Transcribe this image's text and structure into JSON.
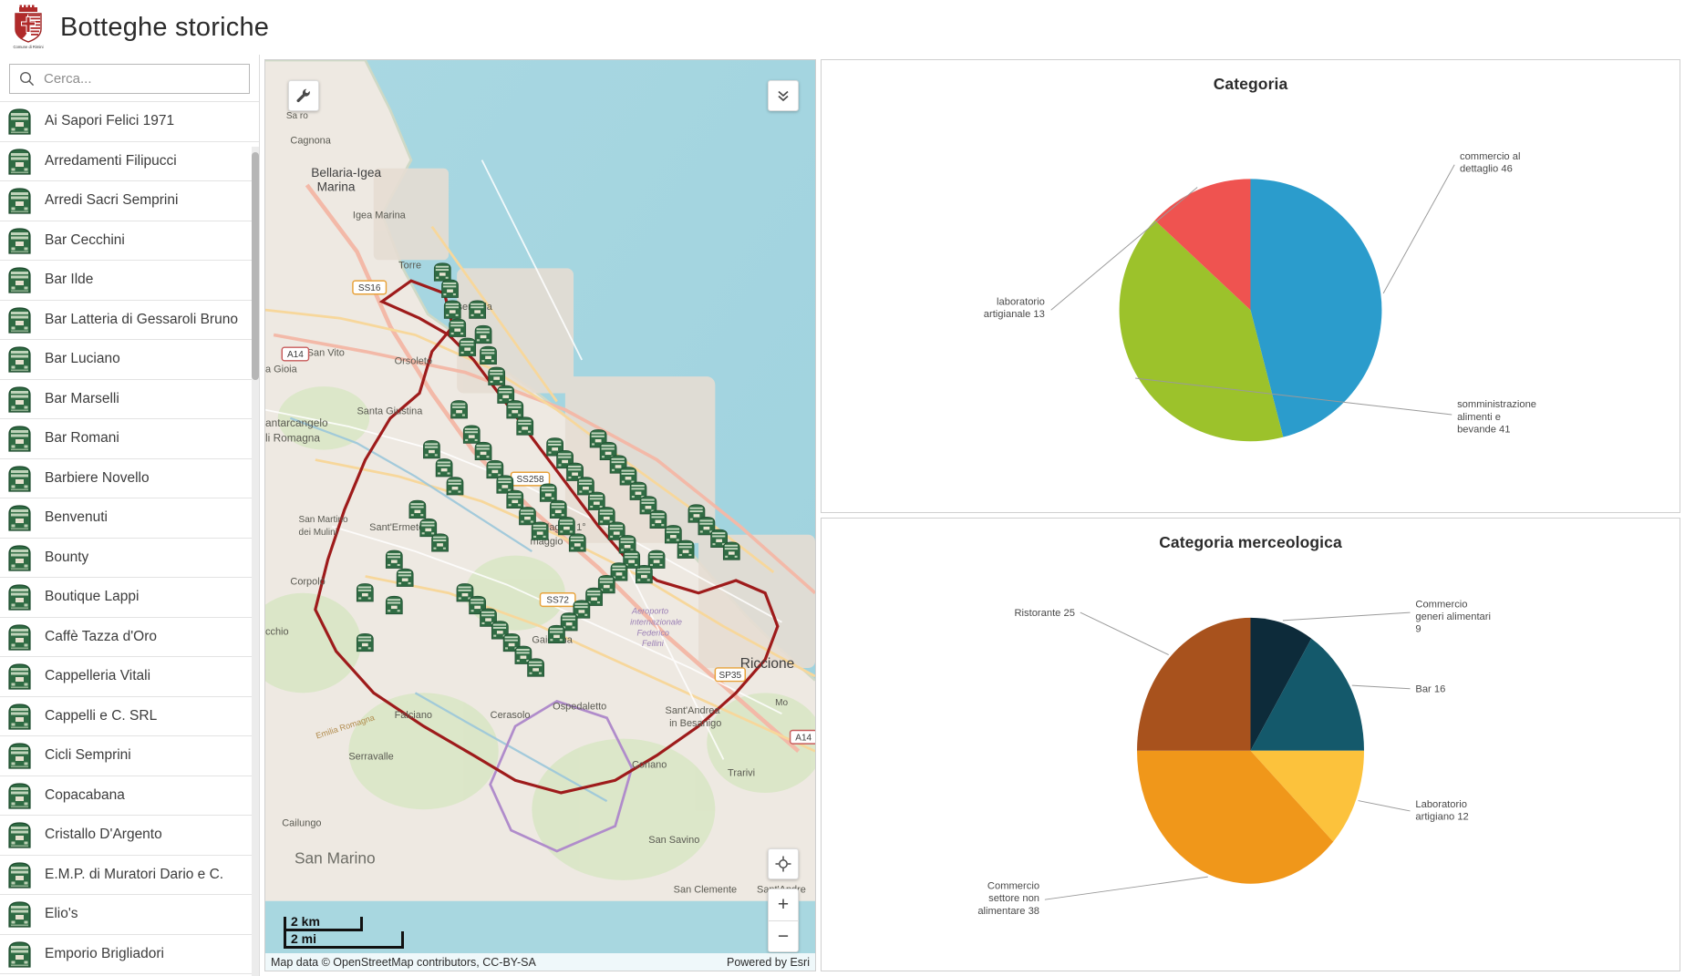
{
  "header": {
    "title": "Botteghe storiche",
    "logo_caption": "Comune di Rimini",
    "logo_icon": "rimini-coat-of-arms-icon"
  },
  "sidebar": {
    "search": {
      "placeholder": "Cerca...",
      "value": "",
      "icon": "search-icon"
    },
    "item_icon": "bottega-storica-plaque-icon",
    "items": [
      {
        "label": "Ai Sapori Felici 1971"
      },
      {
        "label": "Arredamenti Filipucci"
      },
      {
        "label": "Arredi Sacri Semprini"
      },
      {
        "label": "Bar Cecchini"
      },
      {
        "label": "Bar Ilde"
      },
      {
        "label": "Bar Latteria di Gessaroli Bruno"
      },
      {
        "label": "Bar Luciano"
      },
      {
        "label": "Bar Marselli"
      },
      {
        "label": "Bar Romani"
      },
      {
        "label": "Barbiere Novello"
      },
      {
        "label": "Benvenuti"
      },
      {
        "label": "Bounty"
      },
      {
        "label": "Boutique Lappi"
      },
      {
        "label": "Caffè Tazza d'Oro"
      },
      {
        "label": "Cappelleria Vitali"
      },
      {
        "label": "Cappelli e C. SRL"
      },
      {
        "label": "Cicli Semprini"
      },
      {
        "label": "Copacabana"
      },
      {
        "label": "Cristallo D'Argento"
      },
      {
        "label": "E.M.P. di Muratori Dario e C."
      },
      {
        "label": "Elio's"
      },
      {
        "label": "Emporio Brigliadori"
      }
    ]
  },
  "map": {
    "tools_button_icon": "wrench-icon",
    "collapse_button_icon": "double-chevron-down-icon",
    "locate_button_icon": "crosshair-locate-icon",
    "zoom_in_label": "+",
    "zoom_out_label": "−",
    "scalebar": {
      "km": "2 km",
      "mi": "2 mi"
    },
    "attribution": "Map data © OpenStreetMap contributors, CC-BY-SA",
    "powered_by": "Powered by Esri",
    "labels": [
      "Cagnona",
      "Bellaria-Igea Marina",
      "Igea Marina",
      "SS16",
      "A14",
      "Torre",
      "Viserbella",
      "Orsoleto",
      "San Vito",
      "a Gioia",
      "Santa Giustina",
      "antarcangelo",
      "li Romagna",
      "SS258",
      "San Martino dei Mulini",
      "Sant'Ermete",
      "Corpolò",
      "SS72",
      "Villaggio 1° maggio",
      "Aeroporto internazionale Federico Fellini",
      "Riccione",
      "SP35",
      "Gaiofana",
      "cchio",
      "Falciano",
      "Cerasolo",
      "Ospedaletto",
      "Sant'Andrea in Besanigo",
      "Emilia Romagna",
      "Serravalle",
      "Coriano",
      "Cailungo",
      "San Marino",
      "Trarivi",
      "San Savino",
      "San Clemente",
      "Sant'Andrea",
      "Mo"
    ]
  },
  "chart_data": [
    {
      "type": "pie",
      "title": "Categoria",
      "categories": [
        "commercio al dettaglio",
        "somministrazione alimenti e bevande",
        "laboratorio artigianale"
      ],
      "values": [
        46,
        41,
        13
      ],
      "labels": [
        "commercio al dettaglio 46",
        "somministrazione alimenti e bevande 41",
        "laboratorio artigianale 13"
      ],
      "colors": [
        "#2b9ccc",
        "#9cc22b",
        "#ef5350"
      ],
      "legend": "labels-with-leader-lines"
    },
    {
      "type": "pie",
      "title": "Categoria merceologica",
      "categories": [
        "Commercio generi alimentari",
        "Bar",
        "Laboratorio artigiano",
        "Commercio settore non alimentare",
        "Ristorante"
      ],
      "values": [
        9,
        16,
        12,
        38,
        25
      ],
      "labels": [
        "Commercio generi alimentari 9",
        "Bar 16",
        "Laboratorio artigiano 12",
        "Commercio settore non alimentare 38",
        "Ristorante 25"
      ],
      "colors": [
        "#0d2b3a",
        "#14596b",
        "#fcc23c",
        "#f0971a",
        "#a8521d"
      ],
      "legend": "labels-with-leader-lines"
    }
  ]
}
